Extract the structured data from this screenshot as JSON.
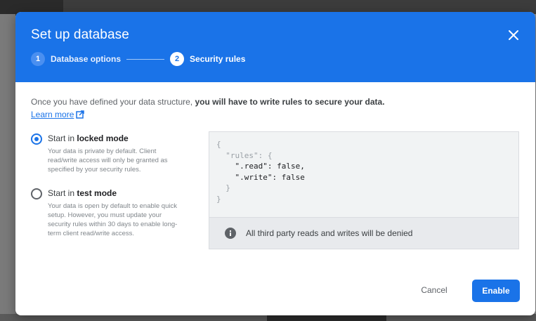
{
  "dialog": {
    "title": "Set up database",
    "close_icon": "close-icon"
  },
  "stepper": {
    "steps": [
      {
        "number": "1",
        "label": "Database options",
        "active": false
      },
      {
        "number": "2",
        "label": "Security rules",
        "active": true
      }
    ]
  },
  "intro": {
    "text_plain": "Once you have defined your data structure, ",
    "text_bold": "you will have to write rules to secure your data.",
    "learn_more": "Learn more",
    "learn_more_icon": "external-link-icon"
  },
  "options": [
    {
      "title_prefix": "Start in ",
      "title_bold": "locked mode",
      "description": "Your data is private by default. Client read/write access will only be granted as specified by your security rules.",
      "selected": true
    },
    {
      "title_prefix": "Start in ",
      "title_bold": "test mode",
      "description": "Your data is open by default to enable quick setup. However, you must update your security rules within 30 days to enable long-term client read/write access.",
      "selected": false
    }
  ],
  "rules_preview": {
    "open_brace": "{",
    "rules_key": "\"rules\": {",
    "read_key": "\".read\"",
    "read_value": "false,",
    "write_key": "\".write\"",
    "write_value": "false",
    "inner_close": "}",
    "outer_close": "}",
    "info_icon": "info-icon",
    "info_text": "All third party reads and writes will be denied"
  },
  "actions": {
    "cancel": "Cancel",
    "enable": "Enable"
  },
  "colors": {
    "accent": "#1a73e8",
    "header_bg": "#1a73e8"
  }
}
